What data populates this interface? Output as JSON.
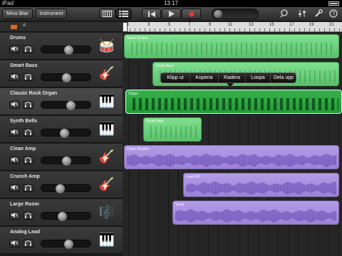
{
  "status_bar": {
    "carrier": "iPad",
    "time": "13:17"
  },
  "toolbar": {
    "songs_label": "Mina låtar",
    "instruments_label": "Instrument",
    "icons": [
      "keyboard-view-icon",
      "tracks-view-icon",
      "rewind-icon",
      "play-icon",
      "record-icon",
      "loop-browser-icon",
      "mixer-icon",
      "settings-icon",
      "help-icon"
    ],
    "record_color": "#e43b2f"
  },
  "ruler": {
    "section_label": "A",
    "bar_numbers": [
      "1",
      "3",
      "5",
      "7",
      "9",
      "11",
      "13",
      "15",
      "17",
      "19",
      "21"
    ]
  },
  "tracks": [
    {
      "name": "Drums",
      "volume": 0.55,
      "instrument_icon": "drum-kit-icon",
      "glyph": "🥁",
      "selected": false
    },
    {
      "name": "Smart Bass",
      "volume": 0.5,
      "instrument_icon": "bass-guitar-icon",
      "glyph": "🎸",
      "selected": false
    },
    {
      "name": "Classic Rock Organ",
      "volume": 0.6,
      "instrument_icon": "organ-icon",
      "glyph": "🎹",
      "selected": true
    },
    {
      "name": "Synth Bells",
      "volume": 0.45,
      "instrument_icon": "synth-keyboard-icon",
      "glyph": "🎹",
      "selected": false
    },
    {
      "name": "Clean Amp",
      "volume": 0.5,
      "instrument_icon": "electric-guitar-icon",
      "glyph": "🎸",
      "selected": false
    },
    {
      "name": "Crunch Amp",
      "volume": 0.35,
      "instrument_icon": "electric-guitar-icon",
      "glyph": "🎸",
      "selected": false
    },
    {
      "name": "Large Room",
      "volume": 0.4,
      "instrument_icon": "piano-icon",
      "glyph": "🎼",
      "selected": false
    },
    {
      "name": "Analog Lead",
      "volume": 0.55,
      "instrument_icon": "synth-keyboard-icon",
      "glyph": "🎹",
      "selected": false
    }
  ],
  "regions": [
    {
      "label": "Smart Drums",
      "color": "green"
    },
    {
      "label": "Smart Bass",
      "color": "green"
    },
    {
      "label": "Organ",
      "color": "green",
      "selected": true
    },
    {
      "label": "Synth Bells",
      "color": "green"
    },
    {
      "label": "Clean Rhythm",
      "color": "purple"
    },
    {
      "label": "Lead Riff",
      "color": "purple"
    },
    {
      "label": "Vocal",
      "color": "purple"
    }
  ],
  "edit_menu": [
    "Klipp ut",
    "Kopiera",
    "Radera",
    "Loopa",
    "Dela upp"
  ],
  "colors": {
    "midi_region": "#6fd582",
    "audio_region": "#a991e0",
    "playhead_marker": "#d06c27"
  }
}
